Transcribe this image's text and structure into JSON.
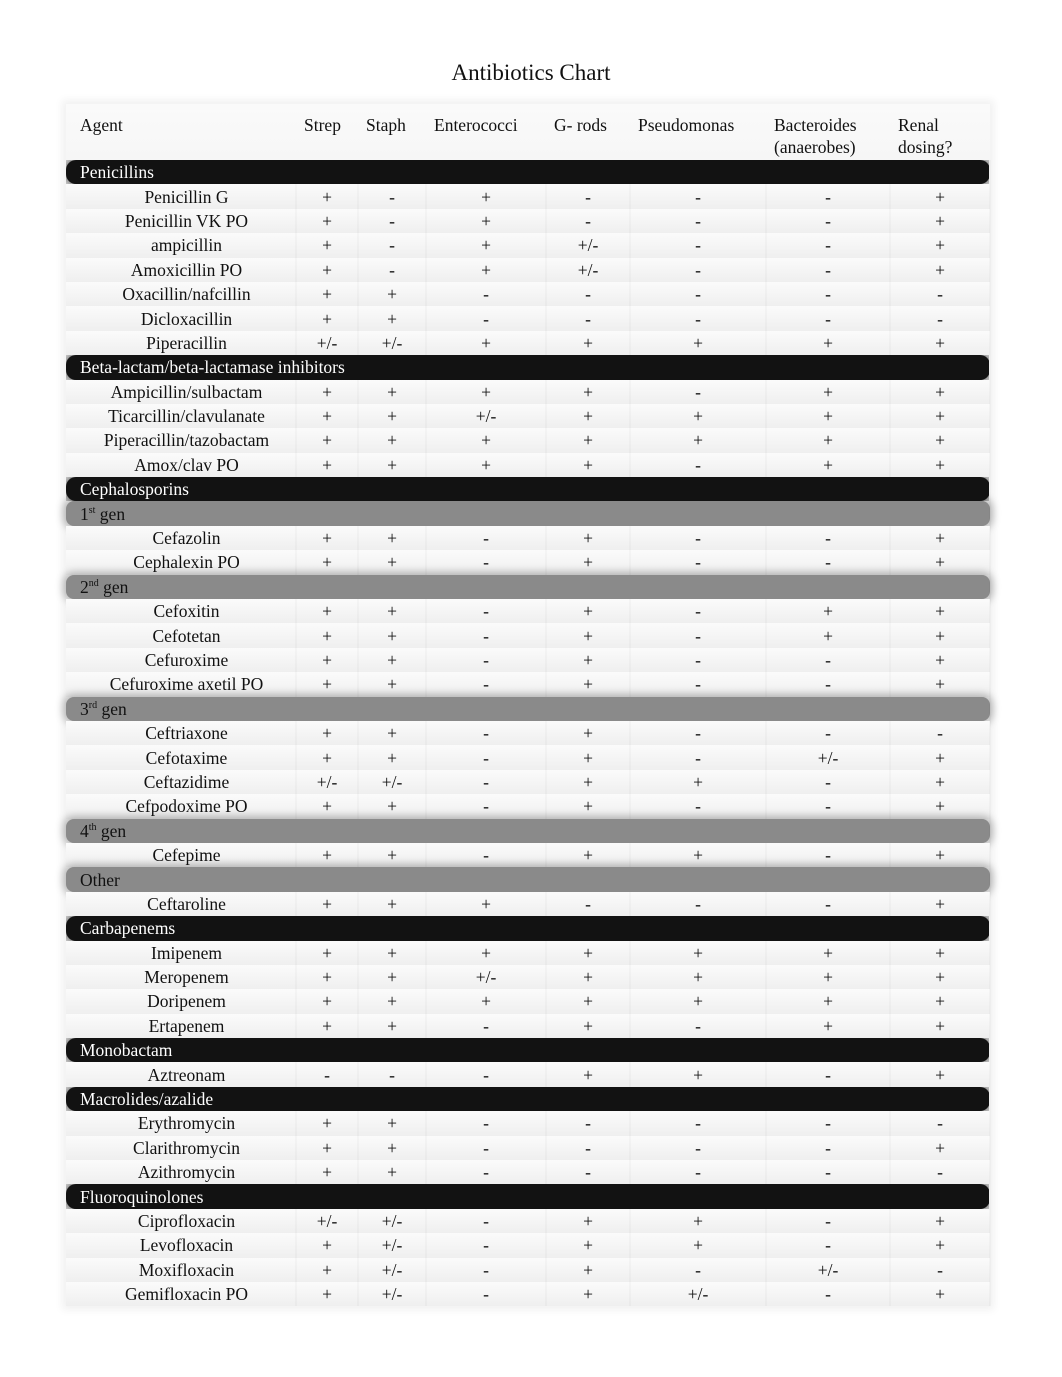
{
  "title": "Antibiotics Chart",
  "columns": [
    "Agent",
    "Strep",
    "Staph",
    "Enterococci",
    "G- rods",
    "Pseudomonas",
    "Bacteroides (anaerobes)",
    "Renal dosing?"
  ],
  "column_lines": {
    "bacteroides": [
      "Bacteroides",
      "(anaerobes)"
    ],
    "renal": [
      "Renal",
      "dosing?"
    ]
  },
  "rows": [
    {
      "type": "category",
      "label": "Penicillins"
    },
    {
      "type": "drug",
      "name": "Penicillin G",
      "values": [
        "+",
        "-",
        "+",
        "-",
        "-",
        "-",
        "+"
      ]
    },
    {
      "type": "drug",
      "name": "Penicillin VK PO",
      "values": [
        "+",
        "-",
        "+",
        "-",
        "-",
        "-",
        "+"
      ]
    },
    {
      "type": "drug",
      "name": "ampicillin",
      "values": [
        "+",
        "-",
        "+",
        "+/-",
        "-",
        "-",
        "+"
      ]
    },
    {
      "type": "drug",
      "name": "Amoxicillin PO",
      "values": [
        "+",
        "-",
        "+",
        "+/-",
        "-",
        "-",
        "+"
      ]
    },
    {
      "type": "drug",
      "name": "Oxacillin/nafcillin",
      "values": [
        "+",
        "+",
        "-",
        "-",
        "-",
        "-",
        "-"
      ]
    },
    {
      "type": "drug",
      "name": "Dicloxacillin",
      "values": [
        "+",
        "+",
        "-",
        "-",
        "-",
        "-",
        "-"
      ]
    },
    {
      "type": "drug",
      "name": "Piperacillin",
      "values": [
        "+/-",
        "+/-",
        "+",
        "+",
        "+",
        "+",
        "+"
      ]
    },
    {
      "type": "category",
      "label": "Beta-lactam/beta-lactamase inhibitors"
    },
    {
      "type": "drug",
      "name": "Ampicillin/sulbactam",
      "values": [
        "+",
        "+",
        "+",
        "+",
        "-",
        "+",
        "+"
      ]
    },
    {
      "type": "drug",
      "name": "Ticarcillin/clavulanate",
      "values": [
        "+",
        "+",
        "+/-",
        "+",
        "+",
        "+",
        "+"
      ]
    },
    {
      "type": "drug",
      "name": "Piperacillin/tazobactam",
      "values": [
        "+",
        "+",
        "+",
        "+",
        "+",
        "+",
        "+"
      ]
    },
    {
      "type": "drug",
      "name": "Amox/clav PO",
      "values": [
        "+",
        "+",
        "+",
        "+",
        "-",
        "+",
        "+"
      ]
    },
    {
      "type": "category",
      "label": "Cephalosporins"
    },
    {
      "type": "subcategory",
      "num": "1",
      "sup": "st",
      "label": " gen"
    },
    {
      "type": "drug",
      "name": "Cefazolin",
      "values": [
        "+",
        "+",
        "-",
        "+",
        "-",
        "-",
        "+"
      ]
    },
    {
      "type": "drug",
      "name": "Cephalexin PO",
      "values": [
        "+",
        "+",
        "-",
        "+",
        "-",
        "-",
        "+"
      ]
    },
    {
      "type": "subcategory",
      "num": "2",
      "sup": "nd",
      "label": " gen"
    },
    {
      "type": "drug",
      "name": "Cefoxitin",
      "values": [
        "+",
        "+",
        "-",
        "+",
        "-",
        "+",
        "+"
      ]
    },
    {
      "type": "drug",
      "name": "Cefotetan",
      "values": [
        "+",
        "+",
        "-",
        "+",
        "-",
        "+",
        "+"
      ]
    },
    {
      "type": "drug",
      "name": "Cefuroxime",
      "values": [
        "+",
        "+",
        "-",
        "+",
        "-",
        "-",
        "+"
      ]
    },
    {
      "type": "drug",
      "name": "Cefuroxime axetil PO",
      "values": [
        "+",
        "+",
        "-",
        "+",
        "-",
        "-",
        "+"
      ]
    },
    {
      "type": "subcategory",
      "num": "3",
      "sup": "rd",
      "label": " gen"
    },
    {
      "type": "drug",
      "name": "Ceftriaxone",
      "values": [
        "+",
        "+",
        "-",
        "+",
        "-",
        "-",
        "-"
      ]
    },
    {
      "type": "drug",
      "name": "Cefotaxime",
      "values": [
        "+",
        "+",
        "-",
        "+",
        "-",
        "+/-",
        "+"
      ]
    },
    {
      "type": "drug",
      "name": "Ceftazidime",
      "values": [
        "+/-",
        "+/-",
        "-",
        "+",
        "+",
        "-",
        "+"
      ]
    },
    {
      "type": "drug",
      "name": "Cefpodoxime PO",
      "values": [
        "+",
        "+",
        "-",
        "+",
        "-",
        "-",
        "+"
      ]
    },
    {
      "type": "subcategory",
      "num": "4",
      "sup": "th",
      "label": " gen"
    },
    {
      "type": "drug",
      "name": "Cefepime",
      "values": [
        "+",
        "+",
        "-",
        "+",
        "+",
        "-",
        "+"
      ]
    },
    {
      "type": "subcategory",
      "num": "",
      "sup": "",
      "label": "Other"
    },
    {
      "type": "drug",
      "name": "Ceftaroline",
      "values": [
        "+",
        "+",
        "+",
        "-",
        "-",
        "-",
        "+"
      ]
    },
    {
      "type": "category",
      "label": "Carbapenems"
    },
    {
      "type": "drug",
      "name": "Imipenem",
      "values": [
        "+",
        "+",
        "+",
        "+",
        "+",
        "+",
        "+"
      ]
    },
    {
      "type": "drug",
      "name": "Meropenem",
      "values": [
        "+",
        "+",
        "+/-",
        "+",
        "+",
        "+",
        "+"
      ]
    },
    {
      "type": "drug",
      "name": "Doripenem",
      "values": [
        "+",
        "+",
        "+",
        "+",
        "+",
        "+",
        "+"
      ]
    },
    {
      "type": "drug",
      "name": "Ertapenem",
      "values": [
        "+",
        "+",
        "-",
        "+",
        "-",
        "+",
        "+"
      ]
    },
    {
      "type": "category",
      "label": "Monobactam"
    },
    {
      "type": "drug",
      "name": "Aztreonam",
      "values": [
        "-",
        "-",
        "-",
        "+",
        "+",
        "-",
        "+"
      ]
    },
    {
      "type": "category",
      "label": "Macrolides/azalide"
    },
    {
      "type": "drug",
      "name": "Erythromycin",
      "values": [
        "+",
        "+",
        "-",
        "-",
        "-",
        "-",
        "-"
      ]
    },
    {
      "type": "drug",
      "name": "Clarithromycin",
      "values": [
        "+",
        "+",
        "-",
        "-",
        "-",
        "-",
        "+"
      ]
    },
    {
      "type": "drug",
      "name": "Azithromycin",
      "values": [
        "+",
        "+",
        "-",
        "-",
        "-",
        "-",
        "-"
      ]
    },
    {
      "type": "category",
      "label": "Fluoroquinolones"
    },
    {
      "type": "drug",
      "name": "Ciprofloxacin",
      "values": [
        "+/-",
        "+/-",
        "-",
        "+",
        "+",
        "-",
        "+"
      ]
    },
    {
      "type": "drug",
      "name": "Levofloxacin",
      "values": [
        "+",
        "+/-",
        "-",
        "+",
        "+",
        "-",
        "+"
      ]
    },
    {
      "type": "drug",
      "name": "Moxifloxacin",
      "values": [
        "+",
        "+/-",
        "-",
        "+",
        "-",
        "+/-",
        "-"
      ]
    },
    {
      "type": "drug",
      "name": "Gemifloxacin PO",
      "values": [
        "+",
        "+/-",
        "-",
        "+",
        "+/-",
        "-",
        "+"
      ]
    }
  ]
}
